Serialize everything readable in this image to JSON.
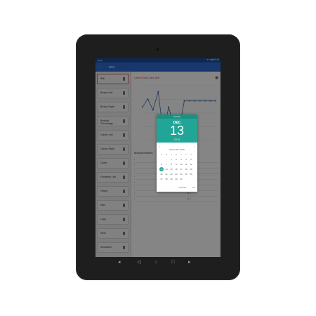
{
  "app": {
    "title": "BMI",
    "status": {
      "left": "▤ ▤",
      "right": "▼ ◀ ▮ 9:40"
    }
  },
  "sidebar": {
    "items": [
      {
        "label": "BMI",
        "selected": true
      },
      {
        "label": "Biceps Left"
      },
      {
        "label": "Biceps Right"
      },
      {
        "label": "Bodyfat Percentage"
      },
      {
        "label": "Calves Left"
      },
      {
        "label": "Calves Right"
      },
      {
        "label": "Chest"
      },
      {
        "label": "Forearms Left"
      },
      {
        "label": "Height"
      },
      {
        "label": "Hips"
      },
      {
        "label": "Legs"
      },
      {
        "label": "Neck"
      },
      {
        "label": "Shoulders"
      }
    ]
  },
  "main": {
    "graph_title": "Latest Graph data: BMI",
    "graph_icon": "settings-icon",
    "measurements_label": "Measurements",
    "rows": [
      {
        "value": "27.1"
      },
      {
        "value": "27.1"
      },
      {
        "value": "27.1"
      },
      {
        "value": "27.1"
      },
      {
        "value": "27.1"
      },
      {
        "value": "24.7"
      },
      {
        "value": "27.3"
      },
      {
        "value": "27.1"
      }
    ]
  },
  "chart_data": {
    "type": "line",
    "title": "",
    "xlabel": "",
    "ylabel": "",
    "series": [
      {
        "values": [
          26.5,
          27.8,
          26.0,
          29.0,
          22.0,
          26.5,
          23.4,
          22.8,
          27.5,
          27.5,
          27.5,
          27.5,
          27.5,
          27.5,
          27.5
        ]
      }
    ],
    "ylim": [
      21,
      30
    ],
    "grid": true
  },
  "dialog": {
    "day_of_week": "Sunday",
    "month": "DEC",
    "date": "13",
    "year": "2015",
    "calendar_title": "December 2015",
    "weekdays": [
      "S",
      "M",
      "T",
      "W",
      "T",
      "F",
      "S"
    ],
    "days": [
      "",
      "",
      "1",
      "2",
      "3",
      "4",
      "5",
      "6",
      "7",
      "8",
      "9",
      "10",
      "11",
      "12",
      "13",
      "14",
      "15",
      "16",
      "17",
      "18",
      "19",
      "20",
      "21",
      "22",
      "23",
      "24",
      "25",
      "26",
      "27",
      "28",
      "29",
      "30",
      "31"
    ],
    "selected_day": "13",
    "cancel": "CANCEL",
    "ok": "OK"
  },
  "colors": {
    "appbar": "#2f6cd1",
    "dialog_header": "#21a596",
    "chart_line": "#3c6fb0",
    "selected_item_border": "#d46a6a"
  }
}
